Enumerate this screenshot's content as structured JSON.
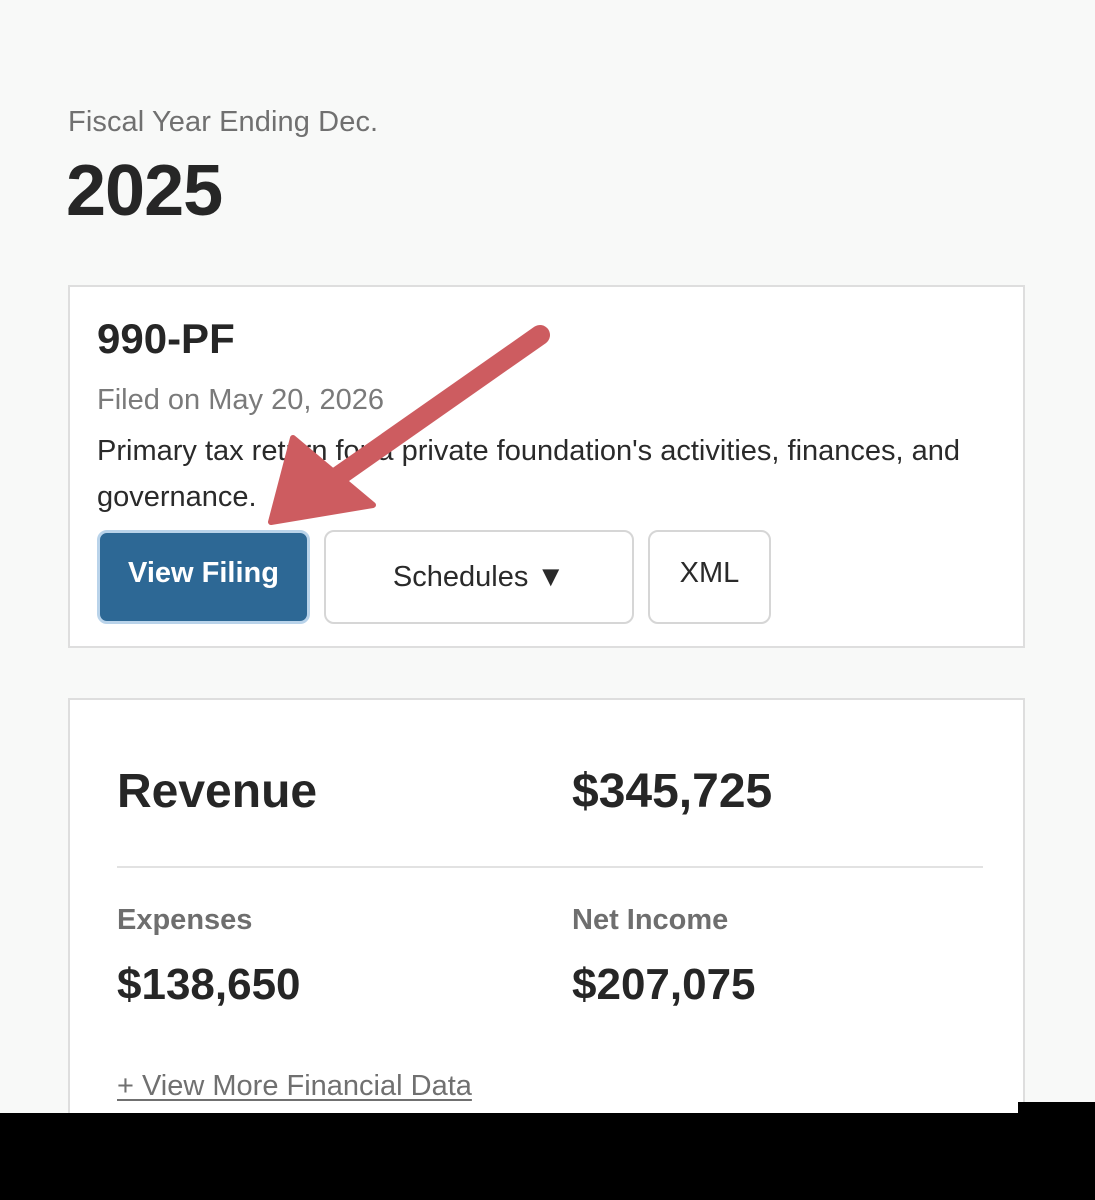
{
  "fiscal_year": {
    "label": "Fiscal Year Ending Dec.",
    "year": "2025"
  },
  "filing": {
    "form": "990-PF",
    "filed_on": "Filed on May 20, 2026",
    "description": "Primary tax return for a private foundation's activities, finances, and governance.",
    "buttons": {
      "view_filing": "View Filing",
      "schedules": "Schedules ▼",
      "xml": "XML"
    }
  },
  "financials": {
    "revenue_label": "Revenue",
    "revenue_value": "$345,725",
    "expenses_label": "Expenses",
    "expenses_value": "$138,650",
    "net_income_label": "Net Income",
    "net_income_value": "$207,075",
    "more_link": "+ View More Financial Data"
  },
  "annotation": {
    "arrow_color": "#cd5c60",
    "points_to": "View Filing"
  },
  "colors": {
    "primary_button": "#2d6895",
    "background": "#f8f9f8"
  }
}
